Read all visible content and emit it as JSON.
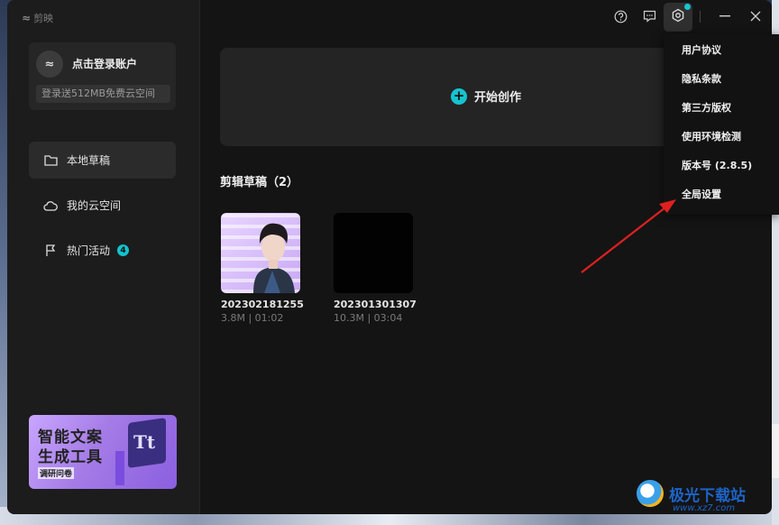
{
  "app": {
    "name": "剪映"
  },
  "account": {
    "avatar_glyph": "≈",
    "login_title": "点击登录账户",
    "cloud_promo": "登录送512MB免费云空间"
  },
  "sidebar": {
    "items": [
      {
        "label": "本地草稿",
        "icon": "folder-icon",
        "active": true
      },
      {
        "label": "我的云空间",
        "icon": "cloud-icon"
      },
      {
        "label": "热门活动",
        "icon": "flag-icon",
        "badge": "4"
      }
    ]
  },
  "banner": {
    "line1": "智能文案",
    "line2": "生成工具",
    "tag": "调研问卷",
    "glyph": "Tt"
  },
  "create": {
    "label": "开始创作",
    "plus": "+"
  },
  "drafts": {
    "title": "剪辑草稿（2）",
    "items": [
      {
        "name": "202302181255",
        "meta": "3.8M | 01:02",
        "thumb": "photo"
      },
      {
        "name": "202301301307",
        "meta": "10.3M | 03:04",
        "thumb": "black"
      }
    ]
  },
  "settings_menu": {
    "items": [
      "用户协议",
      "隐私条款",
      "第三方版权",
      "使用环境检测",
      "版本号 (2.8.5)",
      "全局设置"
    ]
  },
  "watermark": {
    "brand": "极光下载站",
    "site": "www.xz7.com"
  },
  "colors": {
    "accent": "#16c4d0",
    "arrow": "#e02020",
    "bg": "#141414"
  }
}
